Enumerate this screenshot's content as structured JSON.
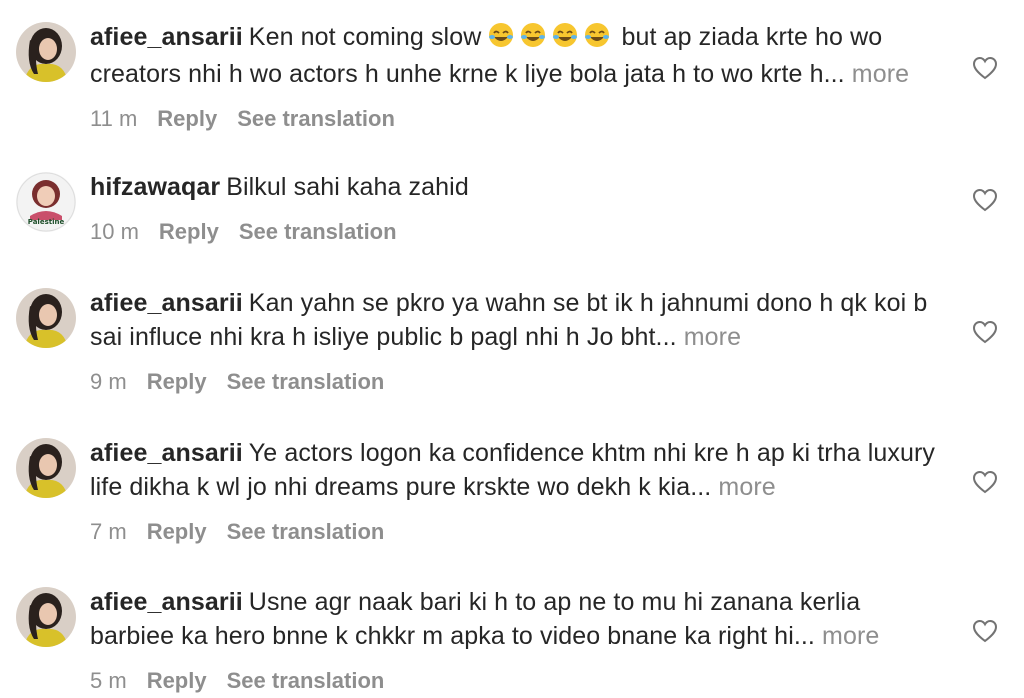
{
  "colors": {
    "text": "#262626",
    "muted": "#8e8e8e",
    "background": "#ffffff"
  },
  "icons": {
    "like": "heart-outline-icon",
    "emoji": "face-with-tears-of-joy"
  },
  "comments": [
    {
      "username": "afiee_ansarii",
      "text_before_emoji": "Ken not coming slow ",
      "emoji_count": 4,
      "text_after_emoji": " but ap ziada krte ho wo creators nhi h wo actors h unhe krne k liye bola jata h to wo krte h...",
      "more": "more",
      "time": "11 m",
      "reply": "Reply",
      "translate": "See translation"
    },
    {
      "username": "hifzawaqar",
      "text": "Bilkul sahi kaha zahid",
      "avatar_caption": "Palestine",
      "time": "10 m",
      "reply": "Reply",
      "translate": "See translation"
    },
    {
      "username": "afiee_ansarii",
      "text": "Kan yahn se pkro ya wahn se bt ik h jahnumi dono h qk koi b sai influce nhi kra h isliye public b pagl nhi h Jo bht...",
      "more": "more",
      "time": "9 m",
      "reply": "Reply",
      "translate": "See translation"
    },
    {
      "username": "afiee_ansarii",
      "text": "Ye actors logon ka confidence khtm nhi kre h ap ki trha luxury life dikha k wl jo nhi dreams pure krskte wo dekh k kia...",
      "more": "more",
      "time": "7 m",
      "reply": "Reply",
      "translate": "See translation"
    },
    {
      "username": "afiee_ansarii",
      "text": "Usne agr naak bari ki h to ap ne to mu hi zanana kerlia barbiee ka hero bnne k chkkr m apka to video bnane ka right hi...",
      "more": "more",
      "time": "5 m",
      "reply": "Reply",
      "translate": "See translation"
    }
  ]
}
